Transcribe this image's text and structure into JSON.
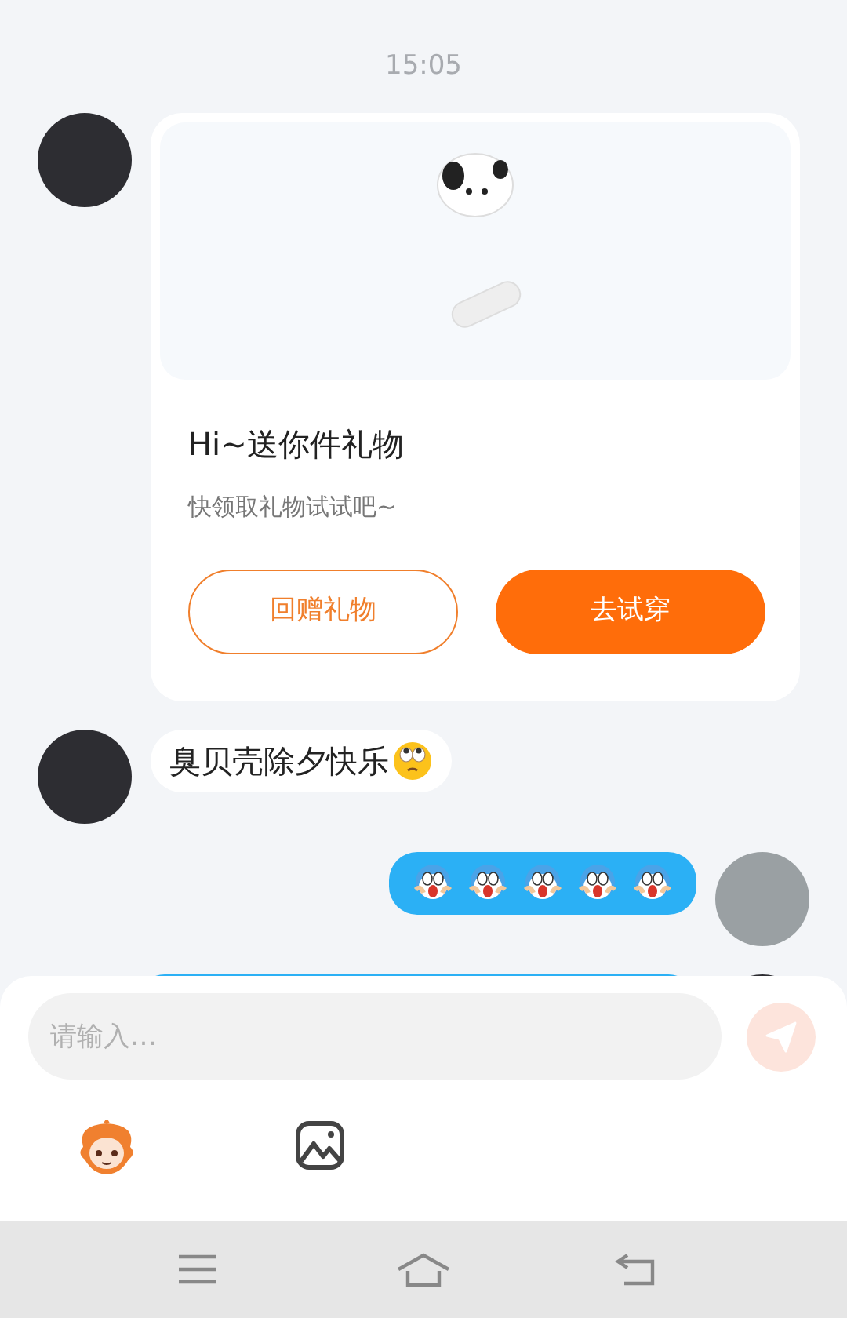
{
  "time": "15:05",
  "messages": [
    {
      "kind": "gift",
      "outgoing": false,
      "title": "Hi~送你件礼物",
      "subtitle": "快领取礼物试试吧~",
      "buttons": [
        {
          "label": "回赠礼物",
          "kind": "outline"
        },
        {
          "label": "去试穿",
          "kind": "filled"
        }
      ]
    },
    {
      "kind": "text",
      "outgoing": false,
      "text": "臭贝壳除夕快乐",
      "emoji": true
    },
    {
      "kind": "stickers",
      "outgoing": true,
      "stickers": [
        {
          "kind": "scared"
        },
        {
          "kind": "scared"
        },
        {
          "kind": "scared"
        },
        {
          "kind": "scared"
        },
        {
          "kind": "scared"
        }
      ]
    },
    {
      "kind": "partial",
      "outgoing": true
    }
  ],
  "input": {
    "placeholder": "请输入…"
  }
}
